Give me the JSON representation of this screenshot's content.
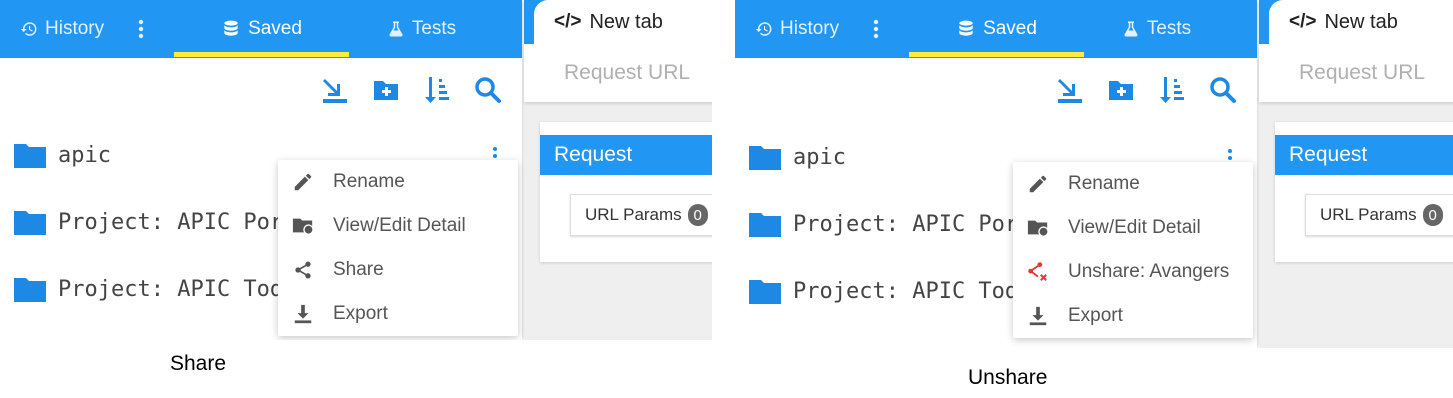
{
  "panels": [
    {
      "tabs": {
        "history": "History",
        "saved": "Saved",
        "tests": "Tests"
      },
      "folders": [
        "apic",
        "Project: APIC Porta",
        "Project: APIC Todo"
      ],
      "menu": [
        {
          "icon": "pencil-icon",
          "label": "Rename"
        },
        {
          "icon": "folder-info-icon",
          "label": "View/Edit Detail"
        },
        {
          "icon": "share-icon",
          "label": "Share"
        },
        {
          "icon": "download-icon",
          "label": "Export"
        }
      ],
      "content": {
        "new_tab": "New tab",
        "url_placeholder": "Request URL",
        "request_header": "Request",
        "url_params": "URL Params",
        "url_params_count": "0"
      },
      "caption": "Share"
    },
    {
      "tabs": {
        "history": "History",
        "saved": "Saved",
        "tests": "Tests"
      },
      "folders": [
        "apic",
        "Project: APIC Porta",
        "Project: APIC Todo"
      ],
      "menu": [
        {
          "icon": "pencil-icon",
          "label": "Rename"
        },
        {
          "icon": "folder-info-icon",
          "label": "View/Edit Detail"
        },
        {
          "icon": "unshare-icon",
          "label": "Unshare: Avangers"
        },
        {
          "icon": "download-icon",
          "label": "Export"
        }
      ],
      "content": {
        "new_tab": "New tab",
        "url_placeholder": "Request URL",
        "request_header": "Request",
        "url_params": "URL Params",
        "url_params_count": "0"
      },
      "caption": "Unshare"
    }
  ],
  "colors": {
    "primary": "#2196f3",
    "active_underline": "#ffeb3b",
    "unshare_icon": "#e53935"
  }
}
